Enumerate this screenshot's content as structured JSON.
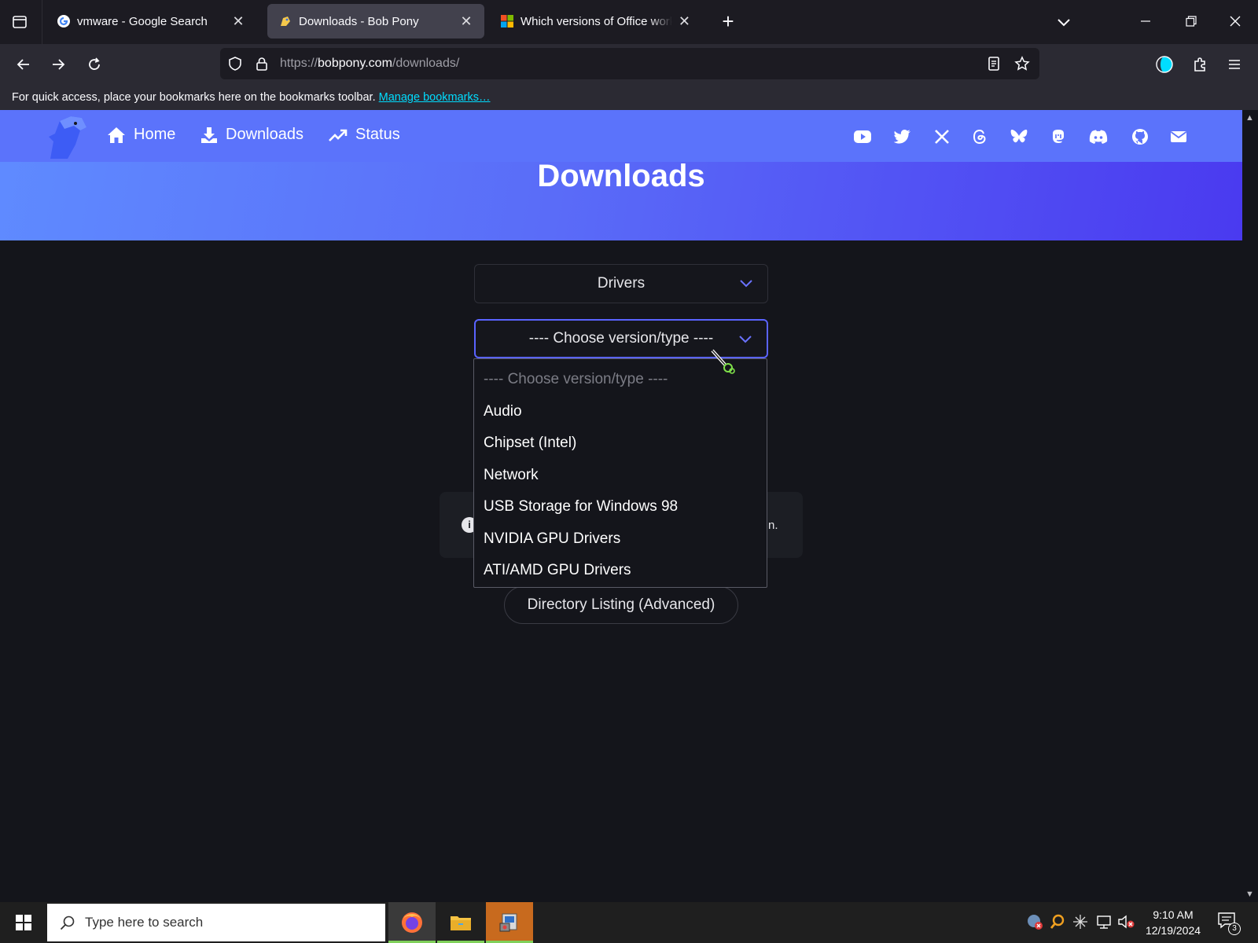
{
  "browser": {
    "tabs": [
      {
        "title": "vmware - Google Search",
        "favicon": "google-icon",
        "active": false
      },
      {
        "title": "Downloads - Bob Pony",
        "favicon": "bobpony-icon",
        "active": true
      },
      {
        "title": "Which versions of Office work with",
        "favicon": "microsoft-icon",
        "active": false
      }
    ],
    "url": {
      "scheme": "https://",
      "host": "bobpony.com",
      "path": "/downloads/"
    },
    "bookmarks_message": "For quick access, place your bookmarks here on the bookmarks toolbar.",
    "bookmarks_link": "Manage bookmarks…"
  },
  "site": {
    "nav": [
      {
        "label": "Home",
        "icon": "home-icon"
      },
      {
        "label": "Downloads",
        "icon": "download-icon"
      },
      {
        "label": "Status",
        "icon": "trend-up-icon"
      }
    ],
    "social_icons": [
      "youtube-icon",
      "twitter-icon",
      "x-icon",
      "threads-icon",
      "bluesky-icon",
      "mastodon-icon",
      "discord-icon",
      "github-icon",
      "email-icon"
    ],
    "page_title": "Downloads",
    "category_select": {
      "value": "Drivers"
    },
    "version_select": {
      "value": "---- Choose version/type ----",
      "options": [
        "---- Choose version/type ----",
        "Audio",
        "Chipset (Intel)",
        "Network",
        "USB Storage for Windows 98",
        "NVIDIA GPU Drivers",
        "ATI/AMD GPU Drivers"
      ]
    },
    "info_tail": "n.",
    "directory_button": "Directory Listing (Advanced)"
  },
  "taskbar": {
    "search_placeholder": "Type here to search",
    "time": "9:10 AM",
    "date": "12/19/2024",
    "notification_count": "3"
  },
  "colors": {
    "accent": "#5a63ff",
    "hero_start": "#5f8bff",
    "hero_end": "#4a3af0",
    "link": "#00ddff"
  }
}
